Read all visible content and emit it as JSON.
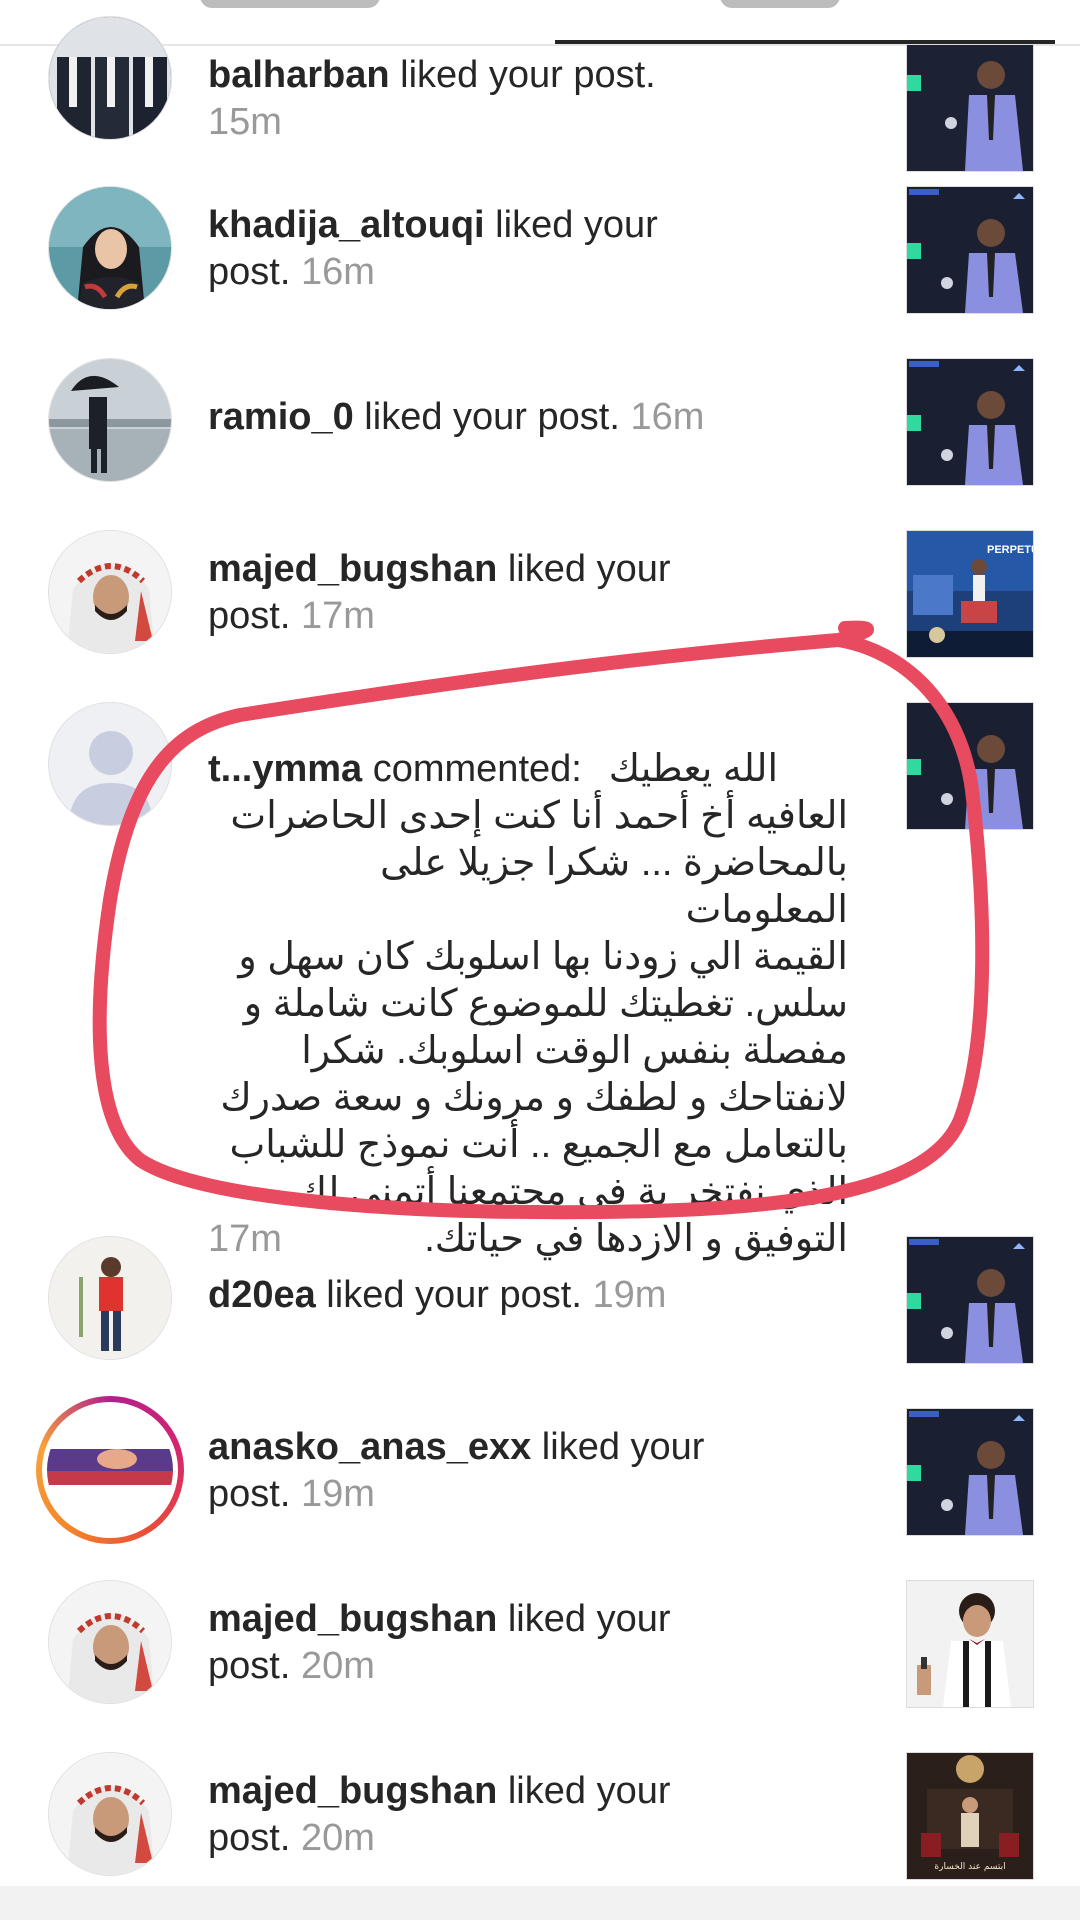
{
  "activity": {
    "items": [
      {
        "user": "balharban",
        "action": " liked your post.",
        "time": "15m",
        "type": "like"
      },
      {
        "user": "khadija_altouqi",
        "action": " liked your post.",
        "time": "16m",
        "type": "like"
      },
      {
        "user": "ramio_0",
        "action": " liked your post.",
        "time": "16m",
        "type": "like"
      },
      {
        "user": "majed_bugshan",
        "action": " liked your post.",
        "time": "17m",
        "type": "like"
      },
      {
        "user": "t...ymma",
        "action": " commented:",
        "time": "17m",
        "type": "comment",
        "comment_lines": [
          "الله يعطيك",
          "العافيه أخ أحمد أنا كنت إحدى الحاضرات",
          "بالمحاضرة ... شكرا جزيلا على المعلومات",
          "القيمة الي زودنا بها اسلوبك كان سهل و",
          "سلس.  تغطيتك للموضوع كانت شاملة و",
          "مفصلة بنفس الوقت اسلوبك.  شكرا",
          "لانفتاحك و لطفك و مرونك و سعة صدرك",
          "بالتعامل مع الجميع .. أنت نموذج للشباب",
          "الذي نفتخر بة في مجتمعنا أتمنى لك",
          "التوفيق و الازدها في حياتك."
        ]
      },
      {
        "user": "d20ea",
        "action": " liked your post.",
        "time": "19m",
        "type": "like"
      },
      {
        "user": "anasko_anas_exx",
        "action": " liked your post.",
        "time": "19m",
        "type": "like"
      },
      {
        "user": "majed_bugshan",
        "action": " liked your post.",
        "time": "20m",
        "type": "like"
      },
      {
        "user": "majed_bugshan",
        "action": " liked your post.",
        "time": "20m",
        "type": "like"
      }
    ]
  },
  "thumbnails": {
    "perpetual_sign": "PERPETU",
    "book_caption": "ابتسم عند الخسارة"
  },
  "colors": {
    "annotation": "#e84a5f",
    "timestamp": "#999999",
    "text": "#262626"
  }
}
